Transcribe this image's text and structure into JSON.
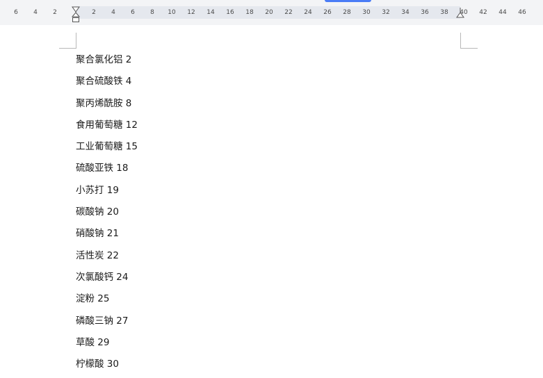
{
  "ruler": {
    "ticks": [
      "6",
      "4",
      "2",
      "2",
      "4",
      "6",
      "8",
      "10",
      "12",
      "14",
      "16",
      "18",
      "20",
      "22",
      "24",
      "26",
      "28",
      "30",
      "32",
      "34",
      "36",
      "38",
      "40",
      "42",
      "44",
      "46"
    ]
  },
  "document": {
    "lines": [
      "聚合氯化铝 2",
      "聚合硫酸铁 4",
      "聚丙烯酰胺 8",
      "食用葡萄糖 12",
      "工业葡萄糖 15",
      "硫酸亚铁 18",
      "小苏打 19",
      "碳酸钠 20",
      "硝酸钠 21",
      "活性炭 22",
      "次氯酸钙 24",
      "淀粉 25",
      "磷酸三钠 27",
      "草酸 29",
      "柠檬酸 30"
    ]
  }
}
